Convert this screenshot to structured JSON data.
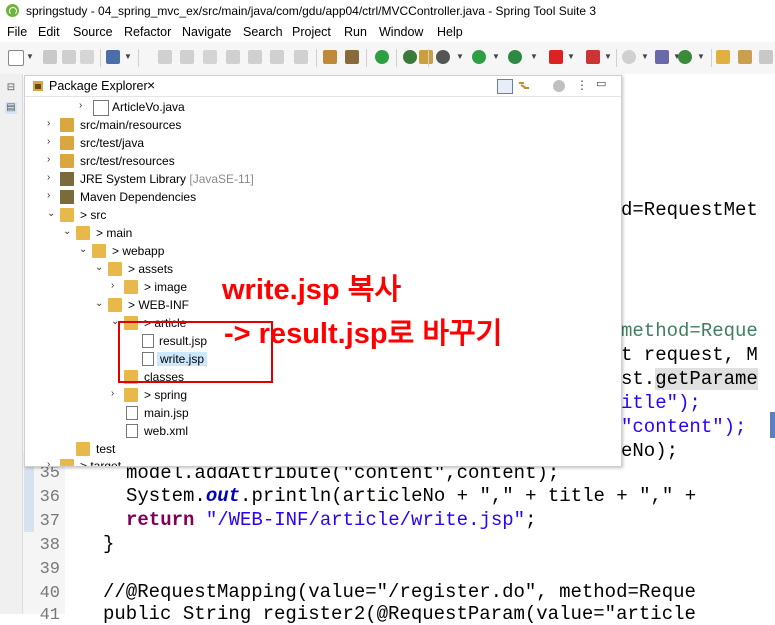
{
  "window": {
    "title": "springstudy - 04_spring_mvc_ex/src/main/java/com/gdu/app04/ctrl/MVCController.java - Spring Tool Suite 3"
  },
  "menu": [
    "File",
    "Edit",
    "Source",
    "Refactor",
    "Navigate",
    "Search",
    "Project",
    "Run",
    "Window",
    "Help"
  ],
  "package_explorer": {
    "title": "Package Explorer",
    "close": "×",
    "tree": [
      {
        "label": "ArticleVo.java",
        "twisty": "›"
      },
      {
        "label": "src/main/resources",
        "twisty": "›"
      },
      {
        "label": "src/test/java",
        "twisty": "›"
      },
      {
        "label": "src/test/resources",
        "twisty": "›"
      },
      {
        "label": "JRE System Library",
        "suffix": "[JavaSE-11]",
        "twisty": "›"
      },
      {
        "label": "Maven Dependencies",
        "twisty": "›"
      },
      {
        "label": "> src",
        "twisty": "⌄"
      },
      {
        "label": "> main",
        "twisty": "⌄"
      },
      {
        "label": "> webapp",
        "twisty": "⌄"
      },
      {
        "label": "> assets",
        "twisty": "⌄"
      },
      {
        "label": "> image",
        "twisty": "›"
      },
      {
        "label": "> WEB-INF",
        "twisty": "⌄"
      },
      {
        "label": "> article",
        "twisty": "⌄"
      },
      {
        "label": "result.jsp",
        "twisty": ""
      },
      {
        "label": "write.jsp",
        "twisty": ""
      },
      {
        "label": "classes",
        "twisty": ""
      },
      {
        "label": "> spring",
        "twisty": "›"
      },
      {
        "label": "main.jsp",
        "twisty": ""
      },
      {
        "label": "web.xml",
        "twisty": ""
      },
      {
        "label": "test",
        "twisty": ""
      },
      {
        "label": "> target",
        "twisty": "›"
      }
    ]
  },
  "editor": {
    "partial_lines": [
      {
        "text": "d=RequestMet"
      },
      {
        "text": "method=Reque"
      },
      {
        "text": "t request, M"
      },
      {
        "pre": "st.",
        "hl": "getParame"
      },
      {
        "text": "itle\");"
      },
      {
        "text": "\"content\");"
      },
      {
        "text": "eNo);"
      }
    ],
    "lines": [
      {
        "no": "35",
        "code": "model.addAttribute(\"content\",content);"
      },
      {
        "no": "36",
        "pre": "System.",
        "field": "out",
        "post": ".println(articleNo + \",\" + title + \",\" +"
      },
      {
        "no": "37",
        "kw": "return",
        "str": "\"/WEB-INF/article/write.jsp\"",
        "post": ";"
      },
      {
        "no": "38",
        "code": "}"
      },
      {
        "no": "39",
        "code": ""
      },
      {
        "no": "40",
        "comment": "//@RequestMapping(value=\"/register.do\", method=Reque"
      },
      {
        "no": "41",
        "code": "public String register2(@RequestParam(value=\"article"
      }
    ]
  },
  "annotation": {
    "line1": "write.jsp 복사",
    "line2": "-> result.jsp로 바꾸기",
    "color": "#ff0000"
  }
}
